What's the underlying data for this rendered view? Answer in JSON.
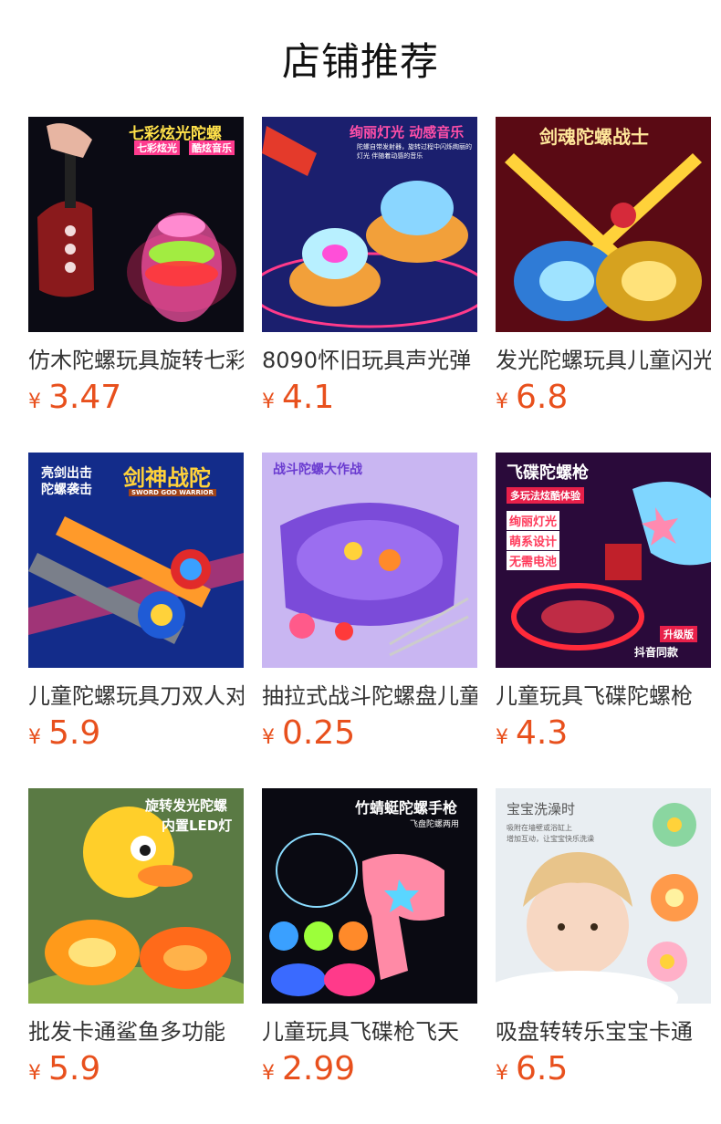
{
  "header": {
    "title": "店铺推荐"
  },
  "currency_symbol": "¥",
  "accent_color": "#e8501d",
  "products": [
    {
      "title": "仿木陀螺玩具旋转七彩",
      "price": "3.47",
      "image": {
        "icon": "light-spinning-top-image",
        "caption": "七彩炫光陀螺",
        "badge_left": "七彩炫光",
        "badge_right": "酷炫音乐"
      }
    },
    {
      "title": "8090怀旧玩具声光弹",
      "price": "4.1",
      "image": {
        "icon": "glowing-tops-image",
        "caption": "绚丽灯光 动感音乐",
        "subcaption": "陀螺自带发射器，旋转过程中闪烁绚丽的灯光 伴随着动感的音乐"
      }
    },
    {
      "title": "发光陀螺玩具儿童闪光",
      "price": "6.8",
      "image": {
        "icon": "sword-spinner-image",
        "caption": "剑魂陀螺战士"
      }
    },
    {
      "title": "儿童陀螺玩具刀双人对",
      "price": "5.9",
      "image": {
        "icon": "sword-top-launcher-image",
        "caption": "剑神战陀",
        "caption_sub": "SWORD GOD WARRIOR",
        "side_text_1": "亮剑出击",
        "side_text_2": "陀螺袭击"
      }
    },
    {
      "title": "抽拉式战斗陀螺盘儿童",
      "price": "0.25",
      "image": {
        "icon": "battle-arena-image",
        "caption": "战斗陀螺大作战"
      }
    },
    {
      "title": "儿童玩具飞碟陀螺枪",
      "price": "4.3",
      "image": {
        "icon": "ufo-top-gun-image",
        "caption": "飞碟陀螺枪",
        "tag_1": "多玩法炫酷体验",
        "tag_2": "绚丽灯光",
        "tag_3": "萌系设计",
        "tag_4": "无需电池",
        "badge": "升级版",
        "brand": "抖音同款"
      }
    },
    {
      "title": "批发卡通鲨鱼多功能",
      "price": "5.9",
      "image": {
        "icon": "duck-top-launcher-image",
        "caption_1": "旋转发光陀螺",
        "caption_2": "内置LED灯"
      }
    },
    {
      "title": "儿童玩具飞碟枪飞天",
      "price": "2.99",
      "image": {
        "icon": "dragonfly-top-gun-image",
        "caption": "竹蜻蜓陀螺手枪",
        "subcaption": "飞盘陀螺两用"
      }
    },
    {
      "title": "吸盘转转乐宝宝卡通",
      "price": "6.5",
      "image": {
        "icon": "suction-spinner-toy-image",
        "caption": "宝宝洗澡时",
        "subcaption_1": "吸附在墙壁或浴缸上",
        "subcaption_2": "增加互动，让宝宝快乐洗澡"
      }
    }
  ]
}
